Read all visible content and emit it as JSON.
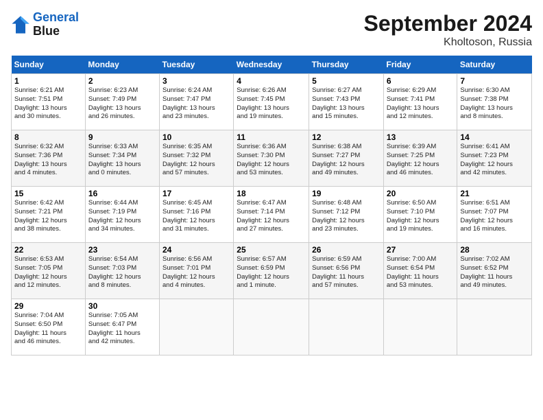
{
  "header": {
    "logo_line1": "General",
    "logo_line2": "Blue",
    "month_title": "September 2024",
    "location": "Kholtoson, Russia"
  },
  "columns": [
    "Sunday",
    "Monday",
    "Tuesday",
    "Wednesday",
    "Thursday",
    "Friday",
    "Saturday"
  ],
  "weeks": [
    [
      {
        "day": "1",
        "sunrise": "6:21 AM",
        "sunset": "7:51 PM",
        "daylight": "13 hours and 30 minutes."
      },
      {
        "day": "2",
        "sunrise": "6:23 AM",
        "sunset": "7:49 PM",
        "daylight": "13 hours and 26 minutes."
      },
      {
        "day": "3",
        "sunrise": "6:24 AM",
        "sunset": "7:47 PM",
        "daylight": "13 hours and 23 minutes."
      },
      {
        "day": "4",
        "sunrise": "6:26 AM",
        "sunset": "7:45 PM",
        "daylight": "13 hours and 19 minutes."
      },
      {
        "day": "5",
        "sunrise": "6:27 AM",
        "sunset": "7:43 PM",
        "daylight": "13 hours and 15 minutes."
      },
      {
        "day": "6",
        "sunrise": "6:29 AM",
        "sunset": "7:41 PM",
        "daylight": "13 hours and 12 minutes."
      },
      {
        "day": "7",
        "sunrise": "6:30 AM",
        "sunset": "7:38 PM",
        "daylight": "13 hours and 8 minutes."
      }
    ],
    [
      {
        "day": "8",
        "sunrise": "6:32 AM",
        "sunset": "7:36 PM",
        "daylight": "13 hours and 4 minutes."
      },
      {
        "day": "9",
        "sunrise": "6:33 AM",
        "sunset": "7:34 PM",
        "daylight": "13 hours and 0 minutes."
      },
      {
        "day": "10",
        "sunrise": "6:35 AM",
        "sunset": "7:32 PM",
        "daylight": "12 hours and 57 minutes."
      },
      {
        "day": "11",
        "sunrise": "6:36 AM",
        "sunset": "7:30 PM",
        "daylight": "12 hours and 53 minutes."
      },
      {
        "day": "12",
        "sunrise": "6:38 AM",
        "sunset": "7:27 PM",
        "daylight": "12 hours and 49 minutes."
      },
      {
        "day": "13",
        "sunrise": "6:39 AM",
        "sunset": "7:25 PM",
        "daylight": "12 hours and 46 minutes."
      },
      {
        "day": "14",
        "sunrise": "6:41 AM",
        "sunset": "7:23 PM",
        "daylight": "12 hours and 42 minutes."
      }
    ],
    [
      {
        "day": "15",
        "sunrise": "6:42 AM",
        "sunset": "7:21 PM",
        "daylight": "12 hours and 38 minutes."
      },
      {
        "day": "16",
        "sunrise": "6:44 AM",
        "sunset": "7:19 PM",
        "daylight": "12 hours and 34 minutes."
      },
      {
        "day": "17",
        "sunrise": "6:45 AM",
        "sunset": "7:16 PM",
        "daylight": "12 hours and 31 minutes."
      },
      {
        "day": "18",
        "sunrise": "6:47 AM",
        "sunset": "7:14 PM",
        "daylight": "12 hours and 27 minutes."
      },
      {
        "day": "19",
        "sunrise": "6:48 AM",
        "sunset": "7:12 PM",
        "daylight": "12 hours and 23 minutes."
      },
      {
        "day": "20",
        "sunrise": "6:50 AM",
        "sunset": "7:10 PM",
        "daylight": "12 hours and 19 minutes."
      },
      {
        "day": "21",
        "sunrise": "6:51 AM",
        "sunset": "7:07 PM",
        "daylight": "12 hours and 16 minutes."
      }
    ],
    [
      {
        "day": "22",
        "sunrise": "6:53 AM",
        "sunset": "7:05 PM",
        "daylight": "12 hours and 12 minutes."
      },
      {
        "day": "23",
        "sunrise": "6:54 AM",
        "sunset": "7:03 PM",
        "daylight": "12 hours and 8 minutes."
      },
      {
        "day": "24",
        "sunrise": "6:56 AM",
        "sunset": "7:01 PM",
        "daylight": "12 hours and 4 minutes."
      },
      {
        "day": "25",
        "sunrise": "6:57 AM",
        "sunset": "6:59 PM",
        "daylight": "12 hours and 1 minute."
      },
      {
        "day": "26",
        "sunrise": "6:59 AM",
        "sunset": "6:56 PM",
        "daylight": "11 hours and 57 minutes."
      },
      {
        "day": "27",
        "sunrise": "7:00 AM",
        "sunset": "6:54 PM",
        "daylight": "11 hours and 53 minutes."
      },
      {
        "day": "28",
        "sunrise": "7:02 AM",
        "sunset": "6:52 PM",
        "daylight": "11 hours and 49 minutes."
      }
    ],
    [
      {
        "day": "29",
        "sunrise": "7:04 AM",
        "sunset": "6:50 PM",
        "daylight": "11 hours and 46 minutes."
      },
      {
        "day": "30",
        "sunrise": "7:05 AM",
        "sunset": "6:47 PM",
        "daylight": "11 hours and 42 minutes."
      },
      null,
      null,
      null,
      null,
      null
    ]
  ]
}
